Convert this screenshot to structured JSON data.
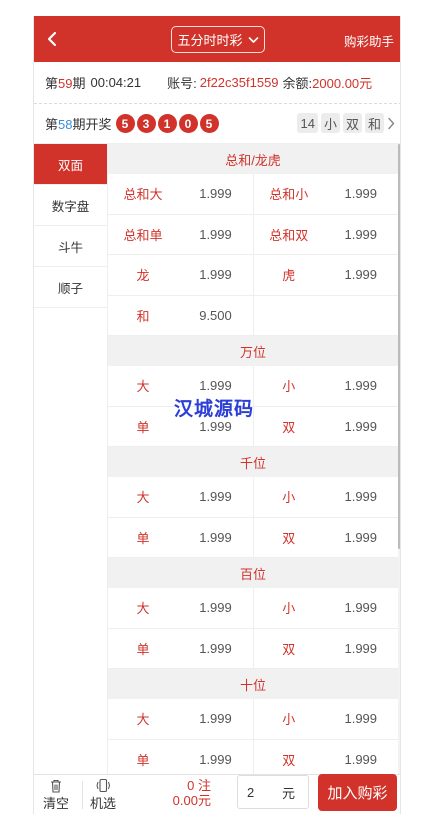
{
  "header": {
    "back_icon": "chevron-left-icon",
    "game_name": "五分时时彩",
    "helper_label": "购彩助手"
  },
  "info": {
    "period_prefix": "第",
    "period_number": "59",
    "period_suffix": "期",
    "countdown": "00:04:21",
    "account_label": "账号:",
    "account_value": "2f22c35f1559",
    "balance_label": "余额:",
    "balance_value": "2000.00元"
  },
  "draw": {
    "prefix": "第",
    "period_number": "58",
    "suffix": "期开奖",
    "balls": [
      "5",
      "3",
      "1",
      "0",
      "5"
    ],
    "tags": [
      "14",
      "小",
      "双",
      "和"
    ]
  },
  "side_menu": [
    {
      "label": "双面",
      "active": true
    },
    {
      "label": "数字盘",
      "active": false
    },
    {
      "label": "斗牛",
      "active": false
    },
    {
      "label": "顺子",
      "active": false
    }
  ],
  "sections": [
    {
      "title": "总和/龙虎",
      "rows": [
        [
          {
            "name": "总和大",
            "odds": "1.999"
          },
          {
            "name": "总和小",
            "odds": "1.999"
          }
        ],
        [
          {
            "name": "总和单",
            "odds": "1.999"
          },
          {
            "name": "总和双",
            "odds": "1.999"
          }
        ],
        [
          {
            "name": "龙",
            "odds": "1.999"
          },
          {
            "name": "虎",
            "odds": "1.999"
          }
        ],
        [
          {
            "name": "和",
            "odds": "9.500"
          },
          null
        ]
      ]
    },
    {
      "title": "万位",
      "rows": [
        [
          {
            "name": "大",
            "odds": "1.999"
          },
          {
            "name": "小",
            "odds": "1.999"
          }
        ],
        [
          {
            "name": "单",
            "odds": "1.999"
          },
          {
            "name": "双",
            "odds": "1.999"
          }
        ]
      ]
    },
    {
      "title": "千位",
      "rows": [
        [
          {
            "name": "大",
            "odds": "1.999"
          },
          {
            "name": "小",
            "odds": "1.999"
          }
        ],
        [
          {
            "name": "单",
            "odds": "1.999"
          },
          {
            "name": "双",
            "odds": "1.999"
          }
        ]
      ]
    },
    {
      "title": "百位",
      "rows": [
        [
          {
            "name": "大",
            "odds": "1.999"
          },
          {
            "name": "小",
            "odds": "1.999"
          }
        ],
        [
          {
            "name": "单",
            "odds": "1.999"
          },
          {
            "name": "双",
            "odds": "1.999"
          }
        ]
      ]
    },
    {
      "title": "十位",
      "rows": [
        [
          {
            "name": "大",
            "odds": "1.999"
          },
          {
            "name": "小",
            "odds": "1.999"
          }
        ],
        [
          {
            "name": "单",
            "odds": "1.999"
          },
          {
            "name": "双",
            "odds": "1.999"
          }
        ]
      ]
    }
  ],
  "watermark": "汉城源码",
  "footer": {
    "clear_label": "清空",
    "clear_icon": "trash-icon",
    "random_label": "机选",
    "random_icon": "shake-phone-icon",
    "bet_count": "0",
    "bet_count_unit": "注",
    "bet_total": "0.00",
    "bet_total_unit": "元",
    "amount_value": "2",
    "amount_unit": "元",
    "add_label": "加入购彩"
  },
  "colors": {
    "brand": "#d1332b",
    "accent_blue": "#3a8fd9",
    "watermark": "#2c3fd6"
  }
}
